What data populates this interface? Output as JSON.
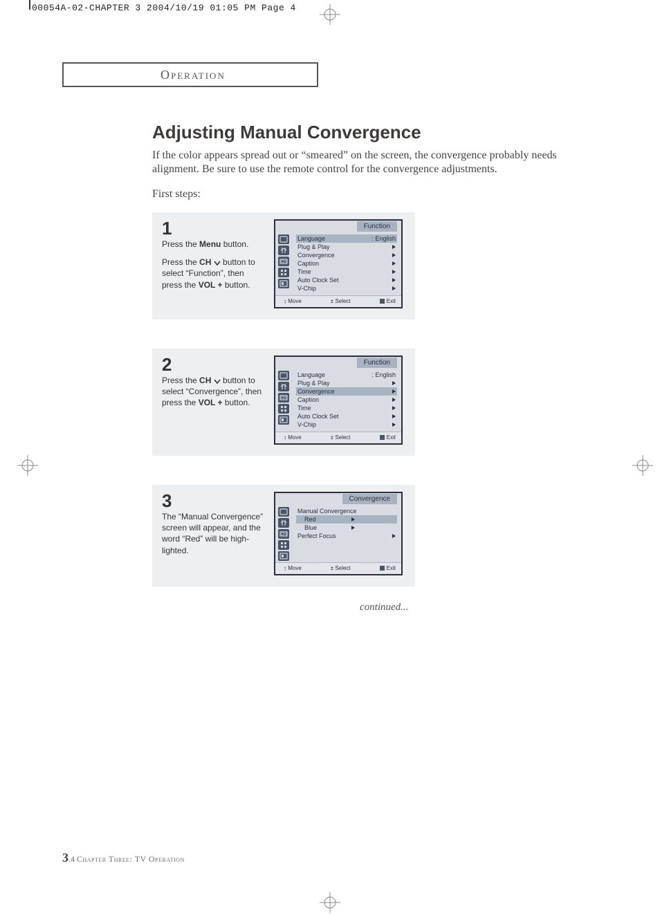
{
  "slug": "00054A-02-CHAPTER 3  2004/10/19  01:05 PM  Page 4",
  "section_tab": "Operation",
  "title": "Adjusting Manual Convergence",
  "intro": "If the color appears spread out or “smeared” on the screen, the convergence probably needs alignment. Be sure to use the remote control for the convergence adjustments.",
  "first_steps": "First steps:",
  "steps": [
    {
      "num": "1",
      "lines": [
        "Press the <b>Menu</b> button.",
        "Press the <b>CH</b> <chev></chev> button to select “Function”, then press the <b>VOL +</b> button."
      ],
      "osd": {
        "title": "Function",
        "rows": [
          {
            "label": "Language",
            "value": ": English",
            "sel": true
          },
          {
            "label": "Plug & Play",
            "tri": true
          },
          {
            "label": "Convergence",
            "tri": true
          },
          {
            "label": "Caption",
            "tri": true
          },
          {
            "label": "Time",
            "tri": true
          },
          {
            "label": "Auto Clock Set",
            "tri": true
          },
          {
            "label": "V-Chip",
            "tri": true
          }
        ],
        "footer": [
          "↕ Move",
          "± Select",
          "Exit"
        ]
      }
    },
    {
      "num": "2",
      "lines": [
        "Press the <b>CH</b> <chev></chev> button to select “Convergence”, then press the <b>VOL +</b> button."
      ],
      "osd": {
        "title": "Function",
        "rows": [
          {
            "label": "Language",
            "value": ": English"
          },
          {
            "label": "Plug & Play",
            "tri": true
          },
          {
            "label": "Convergence",
            "tri": true,
            "sel": true
          },
          {
            "label": "Caption",
            "tri": true
          },
          {
            "label": "Time",
            "tri": true
          },
          {
            "label": "Auto Clock Set",
            "tri": true
          },
          {
            "label": "V-Chip",
            "tri": true
          }
        ],
        "footer": [
          "↕ Move",
          "± Select",
          "Exit"
        ]
      }
    },
    {
      "num": "3",
      "lines": [
        "The “Manual Convergence” screen will appear, and the word “Red” will be high-lighted."
      ],
      "osd": {
        "title": "Convergence",
        "rows_custom": true,
        "group_label": "Manual  Convergence",
        "group_rows": [
          {
            "label": "Red",
            "tri": true,
            "sel": true,
            "indent": true
          },
          {
            "label": "Blue",
            "tri": true,
            "indent": true
          }
        ],
        "extra_row": {
          "label": "Perfect Focus",
          "tri": true
        },
        "footer": [
          "↕ Move",
          "± Select",
          "Exit"
        ]
      }
    }
  ],
  "continued": "continued...",
  "footer": {
    "page_big": "3",
    "page_small": ".4",
    "chapter": " Chapter Three: TV Operation"
  }
}
